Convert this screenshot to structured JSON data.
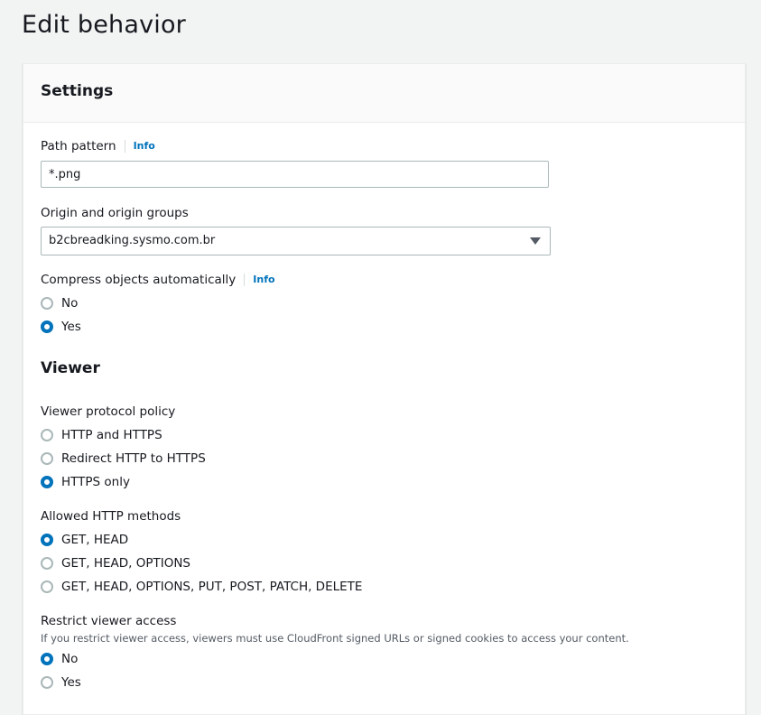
{
  "page": {
    "title": "Edit behavior"
  },
  "settings": {
    "header": "Settings",
    "path_pattern": {
      "label": "Path pattern",
      "info": "Info",
      "value": "*.png"
    },
    "origin": {
      "label": "Origin and origin groups",
      "value": "b2cbreadking.sysmo.com.br"
    },
    "compress": {
      "label": "Compress objects automatically",
      "info": "Info",
      "options": [
        {
          "label": "No",
          "checked": false
        },
        {
          "label": "Yes",
          "checked": true
        }
      ]
    }
  },
  "viewer": {
    "title": "Viewer",
    "protocol_policy": {
      "label": "Viewer protocol policy",
      "options": [
        {
          "label": "HTTP and HTTPS",
          "checked": false
        },
        {
          "label": "Redirect HTTP to HTTPS",
          "checked": false
        },
        {
          "label": "HTTPS only",
          "checked": true
        }
      ]
    },
    "allowed_methods": {
      "label": "Allowed HTTP methods",
      "options": [
        {
          "label": "GET, HEAD",
          "checked": true
        },
        {
          "label": "GET, HEAD, OPTIONS",
          "checked": false
        },
        {
          "label": "GET, HEAD, OPTIONS, PUT, POST, PATCH, DELETE",
          "checked": false
        }
      ]
    },
    "restrict_access": {
      "label": "Restrict viewer access",
      "description": "If you restrict viewer access, viewers must use CloudFront signed URLs or signed cookies to access your content.",
      "options": [
        {
          "label": "No",
          "checked": true
        },
        {
          "label": "Yes",
          "checked": false
        }
      ]
    }
  },
  "colors": {
    "accent": "#0073bb",
    "background": "#f2f3f3",
    "text": "#16191f"
  },
  "icons": {
    "select_caret": "caret-down-icon"
  }
}
